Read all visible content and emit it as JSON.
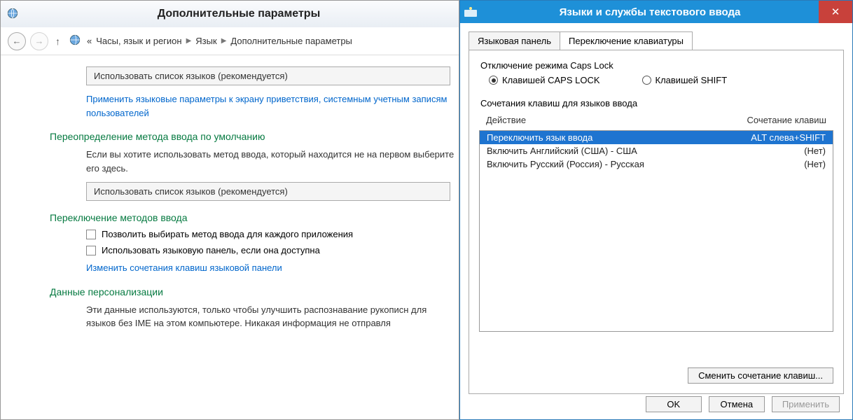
{
  "w1": {
    "title": "Дополнительные параметры",
    "breadcrumb": {
      "prefix": "«",
      "a": "Часы, язык и регион",
      "b": "Язык",
      "c": "Дополнительные параметры"
    },
    "drop1": "Использовать список языков (рекомендуется)",
    "link1": "Применить языковые параметры к экрану приветствия, системным учетным записям пользователей",
    "sect1": "Переопределение метода ввода по умолчанию",
    "para1": "Если вы хотите использовать метод ввода, который находится не на первом выберите его здесь.",
    "drop2": "Использовать список языков (рекомендуется)",
    "sect2": "Переключение методов ввода",
    "chk1": "Позволить выбирать метод ввода для каждого приложения",
    "chk2": "Использовать языковую панель, если она доступна",
    "link2": "Изменить сочетания клавиш языковой панели",
    "sect3": "Данные персонализации",
    "para2": "Эти данные используются, только чтобы улучшить распознавание рукописн для языков без IME на этом компьютере. Никакая информация не отправля"
  },
  "w2": {
    "title": "Языки и службы текстового ввода",
    "tab1": "Языковая панель",
    "tab2": "Переключение клавиатуры",
    "caps_label": "Отключение режима Caps Lock",
    "radio_caps": "Клавишей CAPS LOCK",
    "radio_shift": "Клавишей SHIFT",
    "hotkeys_label": "Сочетания клавиш для языков ввода",
    "col_action": "Действие",
    "col_key": "Сочетание клавиш",
    "rows": [
      {
        "action": "Переключить язык ввода",
        "key": "ALT слева+SHIFT"
      },
      {
        "action": "Включить Английский (США) - США",
        "key": "(Нет)"
      },
      {
        "action": "Включить Русский (Россия) - Русская",
        "key": "(Нет)"
      }
    ],
    "change_btn": "Сменить сочетание клавиш...",
    "ok": "OK",
    "cancel": "Отмена",
    "apply": "Применить"
  }
}
